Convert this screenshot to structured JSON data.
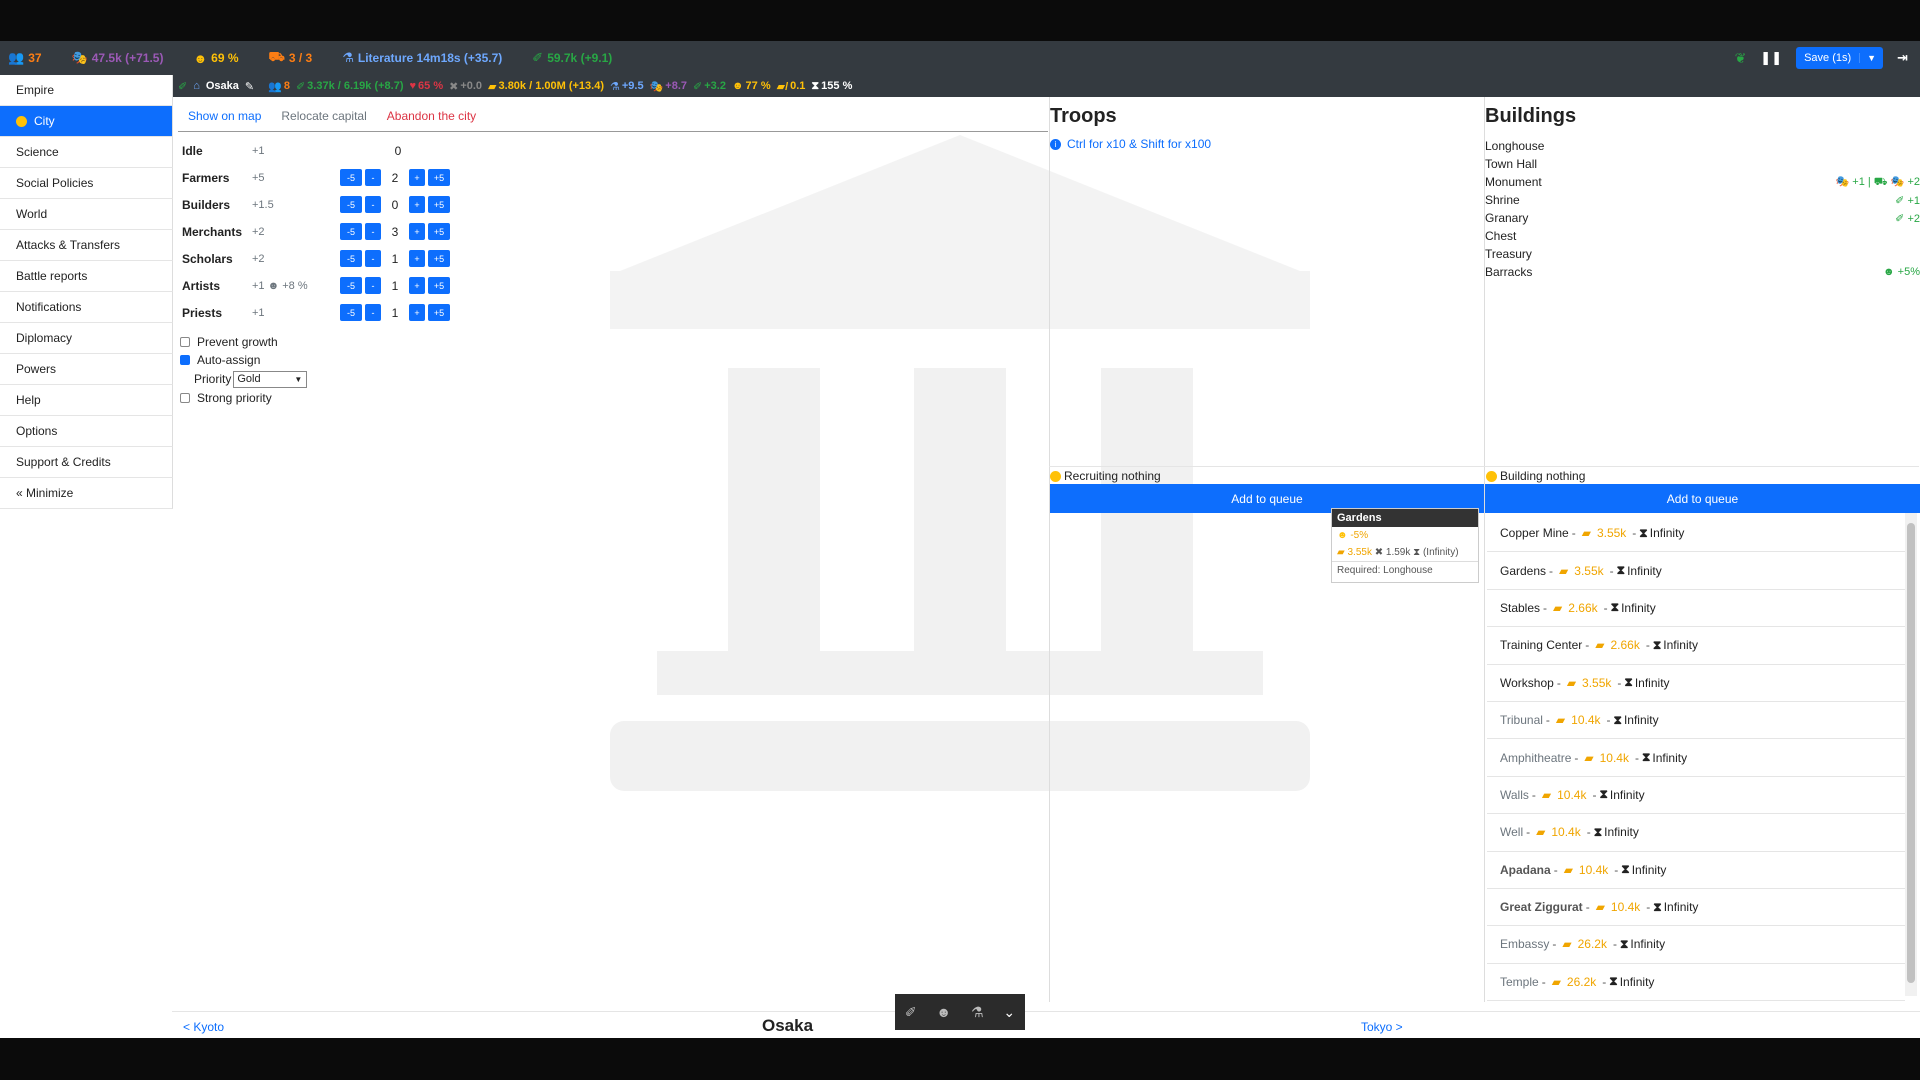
{
  "resources": [
    {
      "icon": "population-icon",
      "glyph": "👥",
      "text": "37",
      "color": "#fd7e14"
    },
    {
      "icon": "culture-icon",
      "glyph": "🎭",
      "text": "47.5k (+71.5)",
      "color": "#9b59b6"
    },
    {
      "icon": "happiness-icon",
      "glyph": "☻",
      "text": "69 %",
      "color": "#ffc107"
    },
    {
      "icon": "army-icon",
      "glyph": "⛟",
      "text": "3 / 3",
      "color": "#fd7e14"
    },
    {
      "icon": "research-icon",
      "glyph": "⚗",
      "text": "Literature 14m18s (+35.7)",
      "color": "#6ea8fe"
    },
    {
      "icon": "faith-icon",
      "glyph": "✐",
      "text": "59.7k (+9.1)",
      "color": "#28a745"
    }
  ],
  "top_controls": {
    "save_label": "Save (1s)"
  },
  "citybar": {
    "name": "Osaka",
    "stats": [
      {
        "text": "8",
        "color": "#fd7e14",
        "glyph": "👥"
      },
      {
        "text": "3.37k / 6.19k (+8.7)",
        "color": "#28a745",
        "glyph": "✐"
      },
      {
        "text": "65 %",
        "color": "#dc3545",
        "glyph": "♥"
      },
      {
        "text": "+0.0",
        "color": "#888",
        "glyph": "✖"
      },
      {
        "text": "3.80k / 1.00M (+13.4)",
        "color": "#ffc107",
        "glyph": "▰"
      },
      {
        "text": "+9.5",
        "color": "#6ea8fe",
        "glyph": "⚗"
      },
      {
        "text": "+8.7",
        "color": "#9b59b6",
        "glyph": "🎭"
      },
      {
        "text": "+3.2",
        "color": "#28a745",
        "glyph": "✐"
      },
      {
        "text": "77 %",
        "color": "#ffc107",
        "glyph": "☻"
      },
      {
        "text": "0.1",
        "color": "#ffc107",
        "glyph": "▰/"
      },
      {
        "text": "155 %",
        "color": "#fff",
        "glyph": "⧗"
      }
    ]
  },
  "sidebar": {
    "items": [
      {
        "label": "Empire"
      },
      {
        "label": "City"
      },
      {
        "label": "Science"
      },
      {
        "label": "Social Policies"
      },
      {
        "label": "World"
      },
      {
        "label": "Attacks & Transfers"
      },
      {
        "label": "Battle reports"
      },
      {
        "label": "Notifications"
      },
      {
        "label": "Diplomacy"
      },
      {
        "label": "Powers"
      },
      {
        "label": "Help"
      },
      {
        "label": "Options"
      },
      {
        "label": "Support & Credits"
      },
      {
        "label": "« Minimize"
      }
    ]
  },
  "city_tabs": {
    "show": "Show on map",
    "relocate": "Relocate capital",
    "abandon": "Abandon the city"
  },
  "workers": [
    {
      "name": "Idle",
      "bonus": "+1",
      "count": "0",
      "buttons": false
    },
    {
      "name": "Farmers",
      "bonus": "+5",
      "count": "2",
      "buttons": true
    },
    {
      "name": "Builders",
      "bonus": "+1.5",
      "count": "0",
      "buttons": true
    },
    {
      "name": "Merchants",
      "bonus": "+2",
      "count": "3",
      "buttons": true
    },
    {
      "name": "Scholars",
      "bonus": "+2",
      "count": "1",
      "buttons": true
    },
    {
      "name": "Artists",
      "bonus": "+1 ☻ +8 %",
      "count": "1",
      "buttons": true
    },
    {
      "name": "Priests",
      "bonus": "+1",
      "count": "1",
      "buttons": true
    }
  ],
  "worker_buttons": {
    "minus5": "-5",
    "minus1": "-",
    "plus1": "+",
    "plus5": "+5"
  },
  "options": {
    "prevent_growth": "Prevent growth",
    "auto_assign": "Auto-assign",
    "priority_label": "Priority",
    "priority_value": "Gold",
    "strong_priority": "Strong priority"
  },
  "troops": {
    "title": "Troops",
    "hint": "Ctrl for x10 & Shift for x100",
    "status": "Recruiting nothing",
    "add_queue": "Add to queue"
  },
  "buildings": {
    "title": "Buildings",
    "list": [
      {
        "name": "Longhouse",
        "bonus": ""
      },
      {
        "name": "Town Hall",
        "bonus": ""
      },
      {
        "name": "Monument",
        "bonus": "🎭 +1 | ⛟ 🎭 +2"
      },
      {
        "name": "Shrine",
        "bonus": "✐ +1"
      },
      {
        "name": "Granary",
        "bonus": "✐ +2"
      },
      {
        "name": "Chest",
        "bonus": ""
      },
      {
        "name": "Treasury",
        "bonus": ""
      },
      {
        "name": "Barracks",
        "bonus": "☻ +5%"
      }
    ],
    "status": "Building nothing",
    "add_queue": "Add to queue"
  },
  "queue": [
    {
      "name": "Copper Mine",
      "cost": "3.55k",
      "time": "Infinity",
      "style": "normal"
    },
    {
      "name": "Gardens",
      "cost": "3.55k",
      "time": "Infinity",
      "style": "normal"
    },
    {
      "name": "Stables",
      "cost": "2.66k",
      "time": "Infinity",
      "style": "normal"
    },
    {
      "name": "Training Center",
      "cost": "2.66k",
      "time": "Infinity",
      "style": "normal"
    },
    {
      "name": "Workshop",
      "cost": "3.55k",
      "time": "Infinity",
      "style": "normal"
    },
    {
      "name": "Tribunal",
      "cost": "10.4k",
      "time": "Infinity",
      "style": "dim"
    },
    {
      "name": "Amphitheatre",
      "cost": "10.4k",
      "time": "Infinity",
      "style": "dim"
    },
    {
      "name": "Walls",
      "cost": "10.4k",
      "time": "Infinity",
      "style": "dim"
    },
    {
      "name": "Well",
      "cost": "10.4k",
      "time": "Infinity",
      "style": "dim"
    },
    {
      "name": "Apadana",
      "cost": "10.4k",
      "time": "Infinity",
      "style": "bold"
    },
    {
      "name": "Great Ziggurat",
      "cost": "10.4k",
      "time": "Infinity",
      "style": "bold"
    },
    {
      "name": "Embassy",
      "cost": "26.2k",
      "time": "Infinity",
      "style": "dim"
    },
    {
      "name": "Temple",
      "cost": "26.2k",
      "time": "Infinity",
      "style": "dim"
    }
  ],
  "tooltip": {
    "title": "Gardens",
    "effect": "-5%",
    "cost_gold": "3.55k",
    "cost_prod": "1.59k",
    "time": "(Infinity)",
    "required": "Required: Longhouse"
  },
  "footer": {
    "prev": "< Kyoto",
    "city": "Osaka",
    "next": "Tokyo >"
  }
}
